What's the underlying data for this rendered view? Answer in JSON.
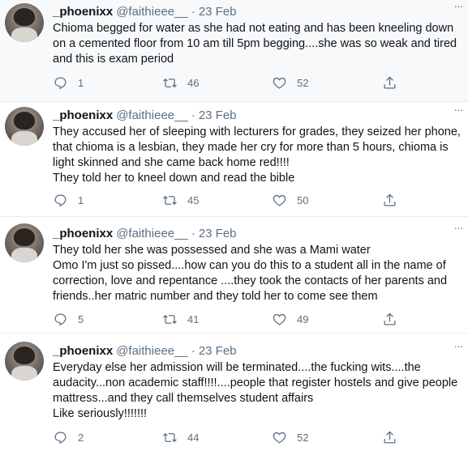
{
  "tweets": [
    {
      "name": "_phoenixx",
      "handle": "@faithieee__",
      "separator": "·",
      "date": "23 Feb",
      "text": "Chioma begged for water as she had not eating and has been kneeling down on a cemented floor from 10 am till 5pm begging....she was so weak and tired and this is exam period",
      "replies": "1",
      "retweets": "46",
      "likes": "52"
    },
    {
      "name": "_phoenixx",
      "handle": "@faithieee__",
      "separator": "·",
      "date": "23 Feb",
      "text": "They accused her of sleeping with lecturers for grades, they seized her phone, that chioma is a lesbian, they made her cry for more than 5 hours, chioma is light skinned and she came back home red!!!!\nThey told her to kneel down and read the bible",
      "replies": "1",
      "retweets": "45",
      "likes": "50"
    },
    {
      "name": "_phoenixx",
      "handle": "@faithieee__",
      "separator": "·",
      "date": "23 Feb",
      "text": "They told her she was possessed and she was a Mami water\nOmo I'm just so pissed....how can you do this to a student all in the name of correction, love and repentance ....they took the contacts of her parents and friends..her matric number and they told her to come see them",
      "replies": "5",
      "retweets": "41",
      "likes": "49"
    },
    {
      "name": "_phoenixx",
      "handle": "@faithieee__",
      "separator": "·",
      "date": "23 Feb",
      "text": "Everyday else her admission will be terminated....the fucking wits....the audacity...non academic staff!!!!....people that register hostels and give people mattress...and they call themselves student affairs\nLike seriously!!!!!!!",
      "replies": "2",
      "retweets": "44",
      "likes": "52"
    }
  ],
  "icons": {
    "reply": "reply-icon",
    "retweet": "retweet-icon",
    "like": "heart-icon",
    "share": "share-icon",
    "more": "more-icon"
  },
  "colors": {
    "text": "#0f1419",
    "secondary": "#5b7083",
    "highlight_bg": "#f7f9fa",
    "divider": "#e6ecf0"
  }
}
